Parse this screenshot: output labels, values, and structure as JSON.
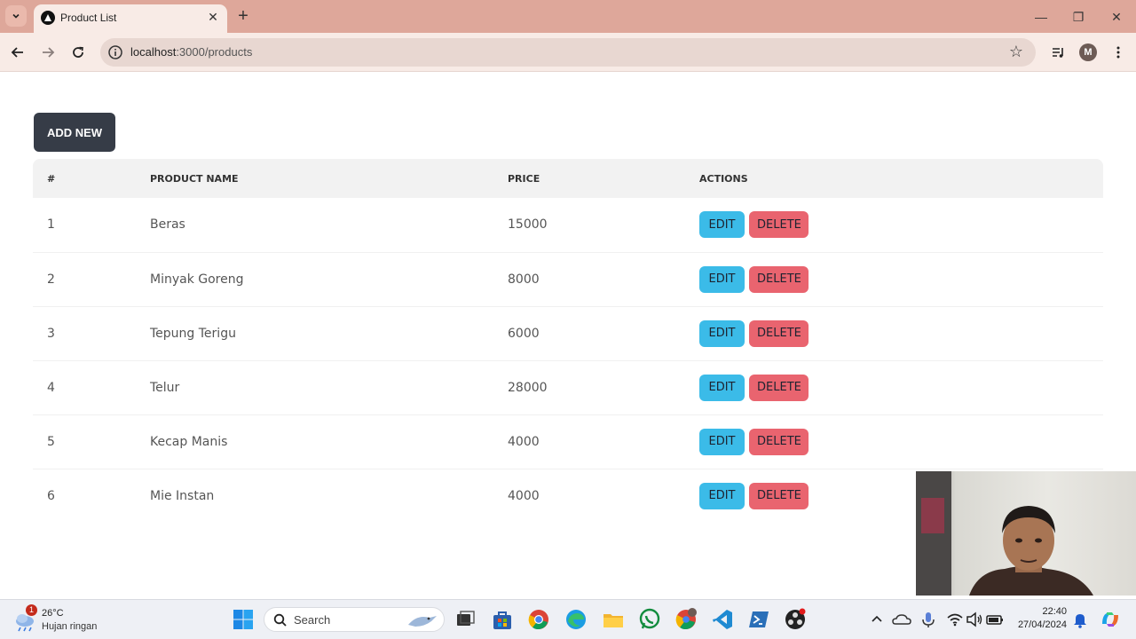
{
  "browser": {
    "tab_title": "Product List",
    "url_host": "localhost",
    "url_path": ":3000/products",
    "profile_initial": "M"
  },
  "page": {
    "add_button": "ADD NEW",
    "columns": [
      "#",
      "PRODUCT NAME",
      "PRICE",
      "ACTIONS"
    ],
    "edit_label": "EDIT",
    "delete_label": "DELETE",
    "rows": [
      {
        "no": "1",
        "name": "Beras",
        "price": "15000"
      },
      {
        "no": "2",
        "name": "Minyak Goreng",
        "price": "8000"
      },
      {
        "no": "3",
        "name": "Tepung Terigu",
        "price": "6000"
      },
      {
        "no": "4",
        "name": "Telur",
        "price": "28000"
      },
      {
        "no": "5",
        "name": "Kecap Manis",
        "price": "4000"
      },
      {
        "no": "6",
        "name": "Mie Instan",
        "price": "4000"
      }
    ]
  },
  "taskbar": {
    "weather_temp": "26°C",
    "weather_condition": "Hujan ringan",
    "weather_badge": "1",
    "search_label": "Search",
    "time": "22:40",
    "date": "27/04/2024"
  },
  "colors": {
    "titlebar": "#dea79a",
    "add_button": "#363c47",
    "edit_button": "#3bbbe8",
    "delete_button": "#e9646f"
  }
}
